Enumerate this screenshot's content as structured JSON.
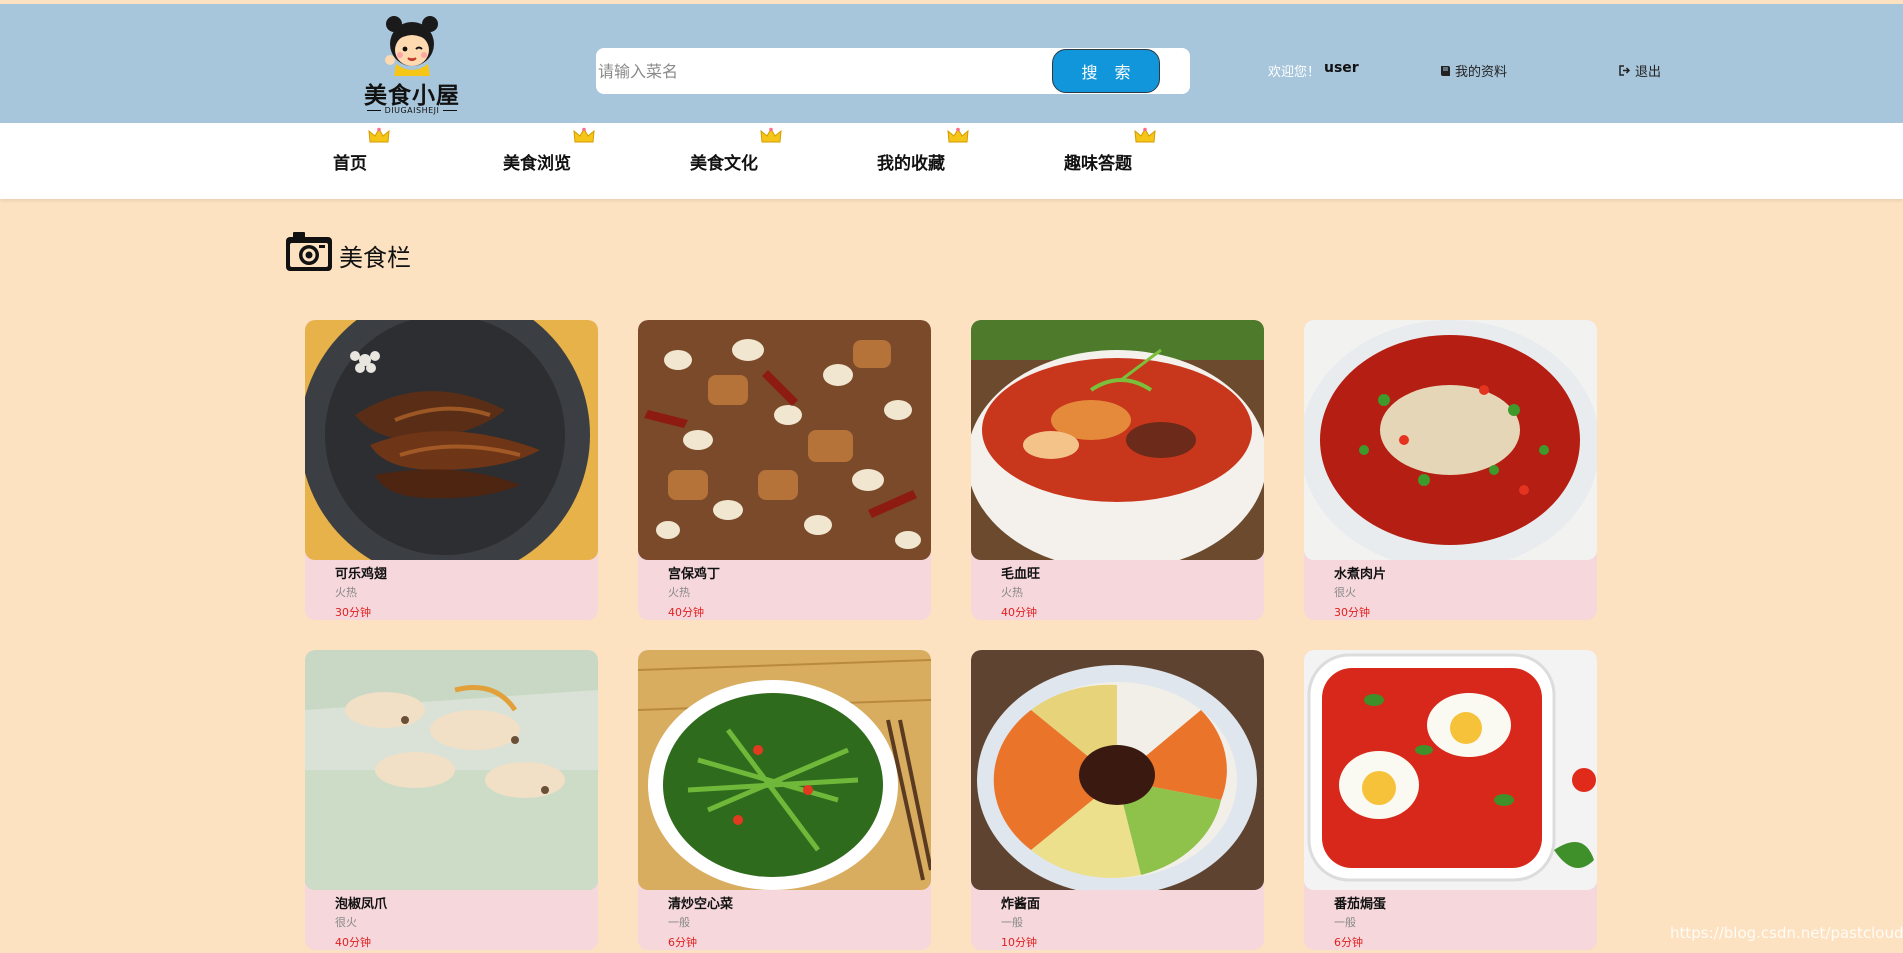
{
  "header": {
    "logo_title": "美食小屋",
    "logo_subtitle": "DIUGAISHEJI",
    "search_placeholder": "请输入菜名",
    "search_button": "搜 索",
    "welcome": "欢迎您！",
    "username": "user",
    "profile_link": "我的资料",
    "logout_link": "退出"
  },
  "nav": {
    "items": [
      {
        "label": "首页"
      },
      {
        "label": "美食浏览"
      },
      {
        "label": "美食文化"
      },
      {
        "label": "我的收藏"
      },
      {
        "label": "趣味答题"
      }
    ]
  },
  "section": {
    "title": "美食栏"
  },
  "dishes": [
    {
      "name": "可乐鸡翅",
      "heat": "火热",
      "time": "30分钟"
    },
    {
      "name": "宫保鸡丁",
      "heat": "火热",
      "time": "40分钟"
    },
    {
      "name": "毛血旺",
      "heat": "火热",
      "time": "40分钟"
    },
    {
      "name": "水煮肉片",
      "heat": "很火",
      "time": "30分钟"
    },
    {
      "name": "泡椒凤爪",
      "heat": "很火",
      "time": "40分钟"
    },
    {
      "name": "清炒空心菜",
      "heat": "一般",
      "time": "6分钟"
    },
    {
      "name": "炸酱面",
      "heat": "一般",
      "time": "10分钟"
    },
    {
      "name": "番茄焗蛋",
      "heat": "一般",
      "time": "6分钟"
    }
  ],
  "watermark": "https://blog.csdn.net/pastclouds",
  "colors": {
    "header_bg": "#a8c6db",
    "page_bg": "#fde2c1",
    "card_bg": "#f6d8dc",
    "accent": "#1296db",
    "time_red": "#e02020"
  },
  "icons": {
    "profile": "book-icon",
    "logout": "sign-out-icon",
    "section": "camera-icon",
    "nav": "crown-icon"
  }
}
